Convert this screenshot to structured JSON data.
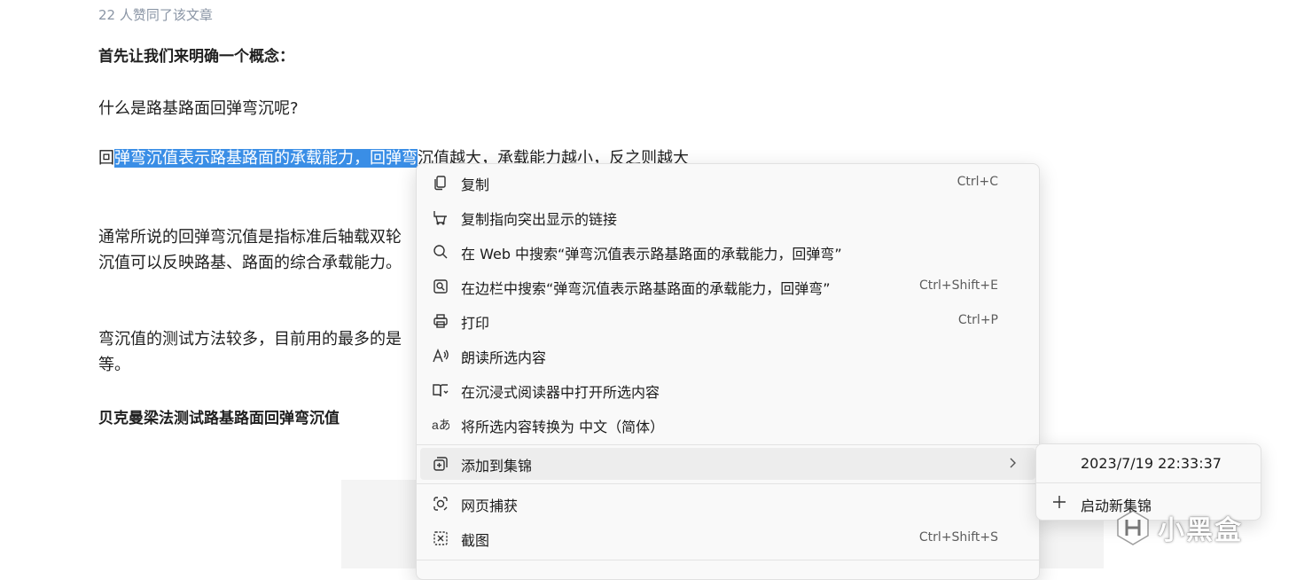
{
  "article": {
    "likes": "22 人赞同了该文章",
    "heading1": "首先让我们来明确一个概念：",
    "question": "什么是路基路面回弹弯沉呢?",
    "para1": {
      "pre": "回",
      "selected": "弹弯沉值表示路基路面的承载能力，回弹弯",
      "post": "沉值越大，承载能力越小，反之则越大"
    },
    "para2_line1": "通常所说的回弹弯沉值是指标准后轴载双轮",
    "para2_line2": "沉值可以反映路基、路面的综合承载能力。",
    "para3_line1": "弯沉值的测试方法较多，目前用的最多的是",
    "para3_line2": "等。",
    "heading2": "贝克曼梁法测试路基路面回弹弯沉值"
  },
  "context_menu": {
    "items": [
      {
        "label": "复制",
        "shortcut": "Ctrl+C",
        "icon": "copy-icon"
      },
      {
        "label": "复制指向突出显示的链接",
        "shortcut": "",
        "icon": "link-highlight-icon"
      },
      {
        "label": "在 Web 中搜索“弹弯沉值表示路基路面的承载能力，回弹弯”",
        "shortcut": "",
        "icon": "search-icon"
      },
      {
        "label": "在边栏中搜索“弹弯沉值表示路基路面的承载能力，回弹弯”",
        "shortcut": "Ctrl+Shift+E",
        "icon": "sidebar-search-icon"
      },
      {
        "label": "打印",
        "shortcut": "Ctrl+P",
        "icon": "printer-icon"
      },
      {
        "label": "朗读所选内容",
        "shortcut": "",
        "icon": "read-aloud-icon"
      },
      {
        "label": "在沉浸式阅读器中打开所选内容",
        "shortcut": "",
        "icon": "immersive-reader-icon"
      },
      {
        "label": "将所选内容转换为 中文（简体）",
        "shortcut": "",
        "icon": "translate-icon"
      },
      {
        "label": "添加到集锦",
        "shortcut": "",
        "icon": "collections-icon"
      },
      {
        "label": "网页捕获",
        "shortcut": "",
        "icon": "web-capture-icon"
      },
      {
        "label": "截图",
        "shortcut": "Ctrl+Shift+S",
        "icon": "screenshot-icon"
      }
    ]
  },
  "submenu": {
    "items": [
      {
        "label": "2023/7/19 22:33:37"
      },
      {
        "label": "启动新集锦",
        "icon": "plus-icon"
      }
    ]
  },
  "watermark": {
    "text": "小黑盒",
    "icon": "heybox-logo-icon"
  }
}
